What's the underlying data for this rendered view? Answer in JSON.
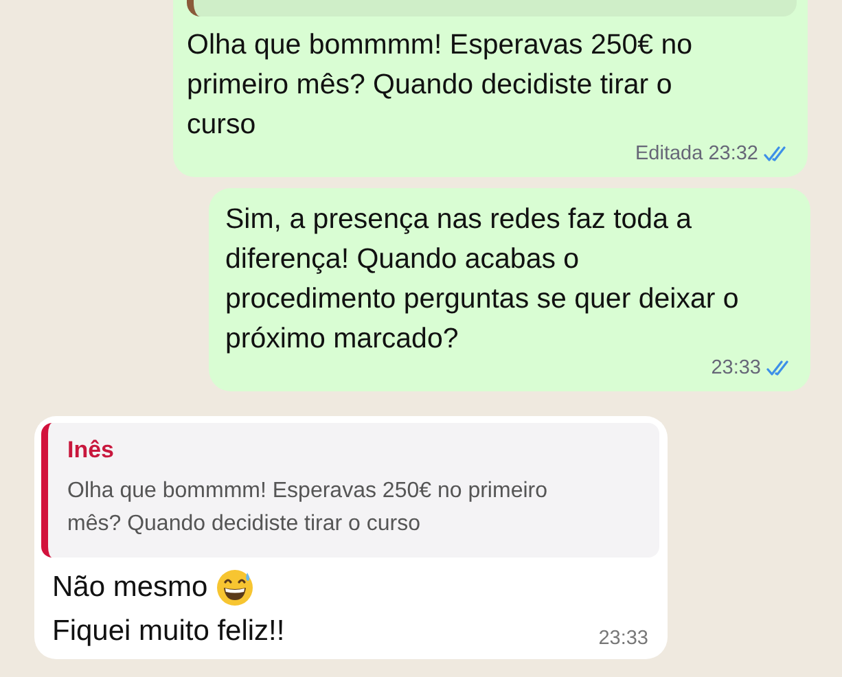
{
  "messages": [
    {
      "kind": "outgoing",
      "has_quote": true,
      "text": "Olha que bommmm! Esperavas 250€ no primeiro mês? Quando decidiste tirar o curso",
      "edited_label": "Editada",
      "time": "23:32",
      "read": true
    },
    {
      "kind": "outgoing",
      "has_quote": false,
      "text": "Sim, a presença nas redes faz toda a diferença! Quando acabas o procedimento perguntas se quer deixar o próximo marcado?",
      "time": "23:33",
      "read": true
    },
    {
      "kind": "incoming",
      "quote": {
        "author": "Inês",
        "text": "Olha que bommmm! Esperavas 250€ no primeiro mês? Quando decidiste tirar o curso"
      },
      "lines": [
        {
          "text": "Não mesmo",
          "emoji": true
        },
        {
          "text": "Fiquei muito feliz!!",
          "emoji": false
        }
      ],
      "time": "23:33"
    }
  ]
}
